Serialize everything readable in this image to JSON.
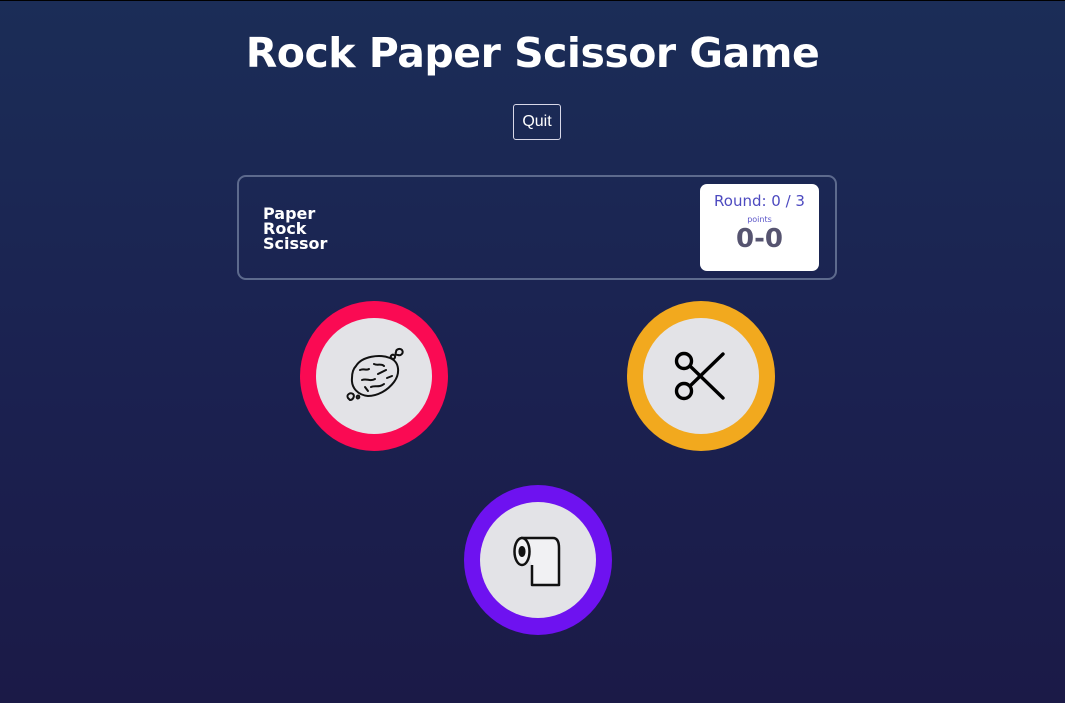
{
  "header": {
    "title": "Rock Paper Scissor Game"
  },
  "controls": {
    "quit_label": "Quit"
  },
  "scoreboard": {
    "logo_lines": [
      "Paper",
      "Rock",
      "Scissor"
    ],
    "round_text": "Round: 0 / 3",
    "points_label": "points",
    "score": "0-0"
  },
  "choices": [
    {
      "name": "rock",
      "icon": "rock-icon",
      "color": "#fa0a53"
    },
    {
      "name": "scissor",
      "icon": "scissors-icon",
      "color": "#f2a91e"
    },
    {
      "name": "paper",
      "icon": "toilet-paper-icon",
      "color": "#6e12f0"
    }
  ],
  "colors": {
    "background_top": "#1b2d57",
    "background_bottom": "#1b1a47",
    "round_text": "#4d4ac0",
    "score_text": "#565470"
  }
}
